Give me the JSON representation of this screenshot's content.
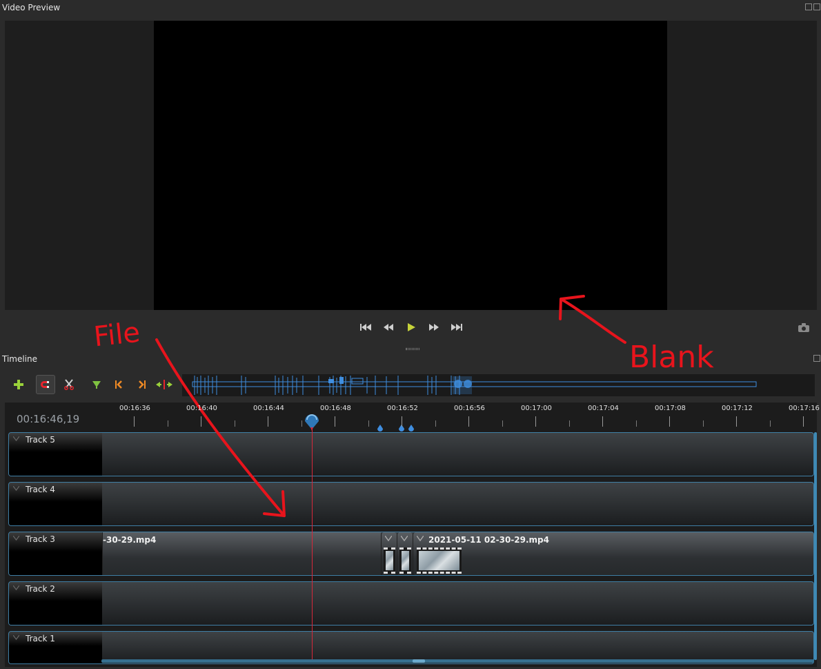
{
  "video_preview": {
    "title": "Video Preview",
    "playback_controls": [
      "jump-start-icon",
      "rewind-icon",
      "play-icon",
      "fast-forward-icon",
      "jump-end-icon"
    ],
    "screenshot_icon": "camera-icon"
  },
  "timeline": {
    "title": "Timeline",
    "toolbar": [
      "add-track-icon",
      "snap-magnet-icon",
      "razor-icon",
      "add-marker-icon",
      "previous-marker-icon",
      "next-marker-icon",
      "center-playhead-icon"
    ],
    "current_time": "00:16:46,19",
    "ruler_labels": [
      "00:16:36",
      "00:16:40",
      "00:16:44",
      "00:16:48",
      "00:16:52",
      "00:16:56",
      "00:17:00",
      "00:17:04",
      "00:17:08",
      "00:17:12",
      "00:17:16"
    ],
    "tracks": [
      {
        "name": "Track 5",
        "clips": []
      },
      {
        "name": "Track 4",
        "clips": []
      },
      {
        "name": "Track 3",
        "clips": [
          {
            "title": "-30-29.mp4"
          },
          {
            "title": ""
          },
          {
            "title": ""
          },
          {
            "title": "2021-05-11 02-30-29.mp4"
          }
        ]
      },
      {
        "name": "Track 2",
        "clips": []
      },
      {
        "name": "Track 1",
        "clips": []
      }
    ]
  },
  "annotations": [
    {
      "text": "File",
      "color": "#e8141c"
    },
    {
      "text": "Blank",
      "color": "#e8141c"
    }
  ],
  "colors": {
    "accent": "#3f8ab5",
    "playhead": "#d8283b",
    "play_button": "#c6d33a",
    "annotation": "#e8141c"
  }
}
